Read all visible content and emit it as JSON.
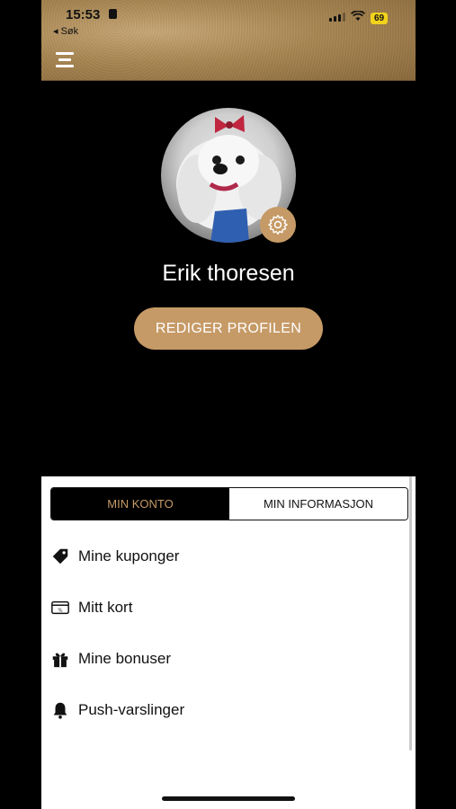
{
  "status_bar": {
    "time": "15:53",
    "back_label": "◂ Søk",
    "battery": "69"
  },
  "profile": {
    "name": "Erik thoresen",
    "edit_button": "REDIGER PROFILEN"
  },
  "tabs": [
    {
      "label": "MIN KONTO",
      "active": true
    },
    {
      "label": "MIN INFORMASJON",
      "active": false
    }
  ],
  "menu_items": [
    {
      "label": "Mine kuponger",
      "icon": "tag-icon"
    },
    {
      "label": "Mitt kort",
      "icon": "card-icon"
    },
    {
      "label": "Mine bonuser",
      "icon": "gift-icon"
    },
    {
      "label": "Push-varslinger",
      "icon": "bell-icon"
    }
  ],
  "colors": {
    "accent": "#c69a66",
    "background": "#000000",
    "panel": "#ffffff"
  }
}
